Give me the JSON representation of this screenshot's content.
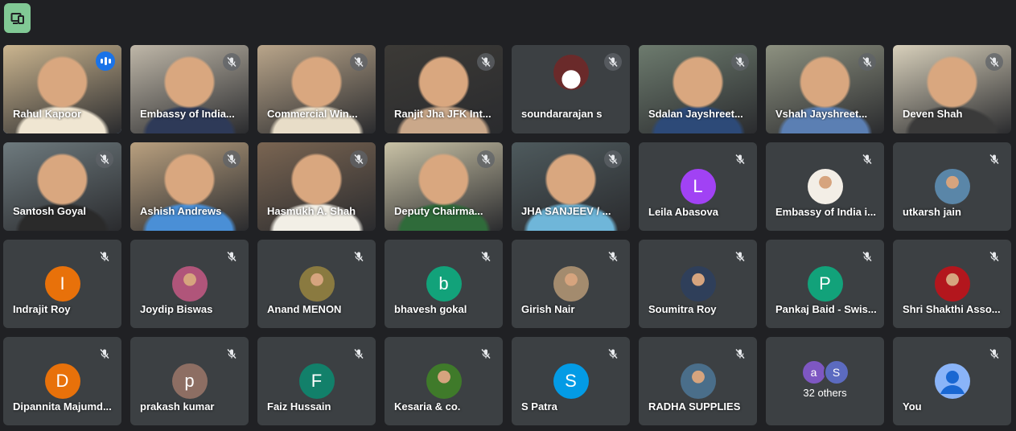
{
  "toolbar": {
    "icon": "devices-icon",
    "accent": "#81c995"
  },
  "video_tiles": [
    {
      "name": "Rahul Kapoor",
      "speaking": true,
      "bg": "#cbb58f",
      "fg": "#f0e6d2"
    },
    {
      "name": "Embassy of India...",
      "bg": "#bfb7a8",
      "fg": "#2e3a58"
    },
    {
      "name": "Commercial Win...",
      "bg": "#b9a58a",
      "fg": "#e8ddc8"
    },
    {
      "name": "Ranjit Jha JFK Int...",
      "bg": "#3c3a36",
      "fg": "#caa88a"
    },
    {
      "name": "soundararajan s",
      "avatar": true,
      "bg": "#3c4043",
      "fg": "#6a2a2a"
    },
    {
      "name": "Sdalan Jayshreet...",
      "bg": "#6d7b6e",
      "fg": "#2d4a78"
    },
    {
      "name": "Vshah Jayshreet...",
      "bg": "#8d9180",
      "fg": "#5b7fb3"
    },
    {
      "name": "Deven Shah",
      "bg": "#d8d0bb",
      "fg": "#3a3a3a"
    },
    {
      "name": "Santosh Goyal",
      "bg": "#6e7a7e",
      "fg": "#2a2a2a"
    },
    {
      "name": "Ashish Andrews",
      "bg": "#b9a07f",
      "fg": "#4a8fd6"
    },
    {
      "name": "Hasmukh A. Shah",
      "bg": "#7a6552",
      "fg": "#f2efe6"
    },
    {
      "name": "Deputy Chairma...",
      "bg": "#c9c2a6",
      "fg": "#2f6b3a"
    },
    {
      "name": "JHA SANJEEV / ...",
      "bg": "#4e5a5d",
      "fg": "#6fb6d9"
    }
  ],
  "participants": [
    {
      "name": "Leila Abasova",
      "initial": "L",
      "color": "#a142f4"
    },
    {
      "name": "Embassy of India i...",
      "photo": "#f3eee6"
    },
    {
      "name": "utkarsh jain",
      "photo": "#5a86a8"
    },
    {
      "name": "Indrajit Roy",
      "initial": "I",
      "color": "#e8710a"
    },
    {
      "name": "Joydip Biswas",
      "photo": "#b0557a"
    },
    {
      "name": "Anand MENON",
      "photo": "#8a7a40"
    },
    {
      "name": "bhavesh gokal",
      "initial": "b",
      "color": "#12a27a"
    },
    {
      "name": "Girish Nair",
      "photo": "#a38b6e"
    },
    {
      "name": "Soumitra Roy",
      "photo": "#2f3f5a"
    },
    {
      "name": "Pankaj Baid - Swis...",
      "initial": "P",
      "color": "#12a27a"
    },
    {
      "name": "Shri Shakthi Asso...",
      "photo": "#b3161d"
    },
    {
      "name": "Dipannita Majumd...",
      "initial": "D",
      "color": "#e8710a"
    },
    {
      "name": "prakash kumar",
      "initial": "p",
      "color": "#8d6e63"
    },
    {
      "name": "Faiz Hussain",
      "initial": "F",
      "color": "#12806a"
    },
    {
      "name": "Kesaria & co.",
      "photo": "#3f7a2a"
    },
    {
      "name": "S Patra",
      "initial": "S",
      "color": "#039be5"
    },
    {
      "name": "RADHA SUPPLIES",
      "photo": "#4a6e8a"
    }
  ],
  "others_tile": {
    "label": "32 others",
    "avatars": [
      {
        "initial": "a",
        "color": "#7e57c2"
      },
      {
        "initial": "S",
        "color": "#5c6bc0"
      }
    ]
  },
  "self_tile": {
    "name": "You",
    "color": "#8ab4f8"
  }
}
